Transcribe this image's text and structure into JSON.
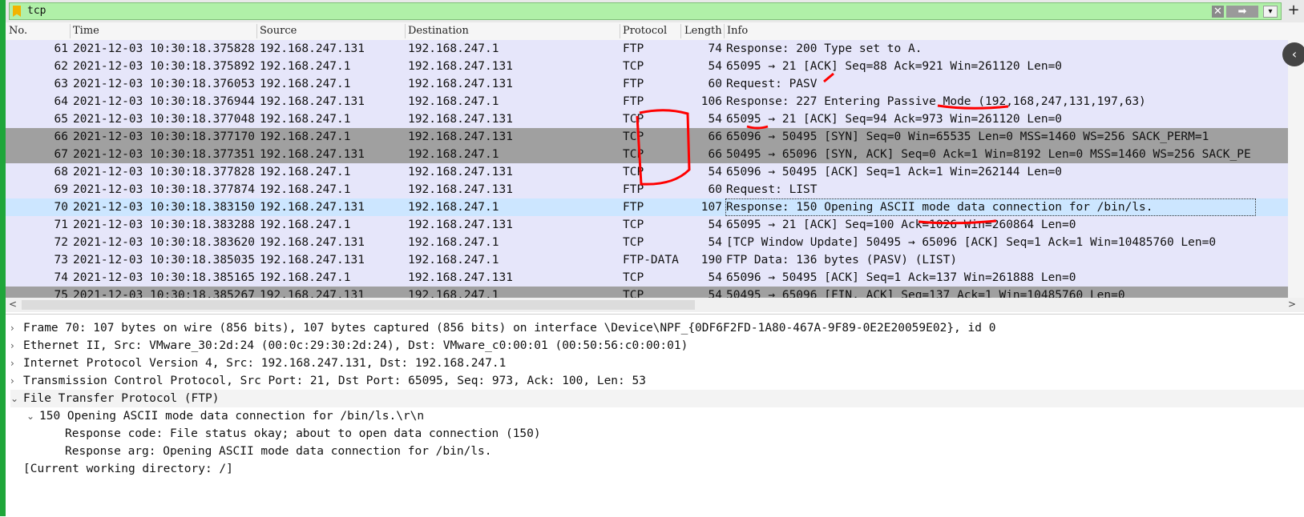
{
  "filter": {
    "value": "tcp",
    "clear_glyph": "✕",
    "apply_glyph": "➡",
    "dropdown_glyph": "▾",
    "add_glyph": "+"
  },
  "columns": {
    "no": "No.",
    "time": "Time",
    "source": "Source",
    "destination": "Destination",
    "protocol": "Protocol",
    "length": "Length",
    "info": "Info"
  },
  "packets": [
    {
      "no": "61",
      "time": "2021-12-03 10:30:18.375828",
      "src": "192.168.247.131",
      "dst": "192.168.247.1",
      "proto": "FTP",
      "len": "74",
      "info": "Response: 200 Type set to A.",
      "style": "ftp"
    },
    {
      "no": "62",
      "time": "2021-12-03 10:30:18.375892",
      "src": "192.168.247.1",
      "dst": "192.168.247.131",
      "proto": "TCP",
      "len": "54",
      "info": "65095 → 21 [ACK] Seq=88 Ack=921 Win=261120 Len=0",
      "style": "tcp"
    },
    {
      "no": "63",
      "time": "2021-12-03 10:30:18.376053",
      "src": "192.168.247.1",
      "dst": "192.168.247.131",
      "proto": "FTP",
      "len": "60",
      "info": "Request: PASV",
      "style": "ftp"
    },
    {
      "no": "64",
      "time": "2021-12-03 10:30:18.376944",
      "src": "192.168.247.131",
      "dst": "192.168.247.1",
      "proto": "FTP",
      "len": "106",
      "info": "Response: 227 Entering Passive Mode (192,168,247,131,197,63)",
      "style": "ftp"
    },
    {
      "no": "65",
      "time": "2021-12-03 10:30:18.377048",
      "src": "192.168.247.1",
      "dst": "192.168.247.131",
      "proto": "TCP",
      "len": "54",
      "info": "65095 → 21 [ACK] Seq=94 Ack=973 Win=261120 Len=0",
      "style": "tcp"
    },
    {
      "no": "66",
      "time": "2021-12-03 10:30:18.377170",
      "src": "192.168.247.1",
      "dst": "192.168.247.131",
      "proto": "TCP",
      "len": "66",
      "info": "65096 → 50495 [SYN] Seq=0 Win=65535 Len=0 MSS=1460 WS=256 SACK_PERM=1",
      "style": "syn"
    },
    {
      "no": "67",
      "time": "2021-12-03 10:30:18.377351",
      "src": "192.168.247.131",
      "dst": "192.168.247.1",
      "proto": "TCP",
      "len": "66",
      "info": "50495 → 65096 [SYN, ACK] Seq=0 Ack=1 Win=8192 Len=0 MSS=1460 WS=256 SACK_PE",
      "style": "syn"
    },
    {
      "no": "68",
      "time": "2021-12-03 10:30:18.377828",
      "src": "192.168.247.1",
      "dst": "192.168.247.131",
      "proto": "TCP",
      "len": "54",
      "info": "65096 → 50495 [ACK] Seq=1 Ack=1 Win=262144 Len=0",
      "style": "tcp"
    },
    {
      "no": "69",
      "time": "2021-12-03 10:30:18.377874",
      "src": "192.168.247.1",
      "dst": "192.168.247.131",
      "proto": "FTP",
      "len": "60",
      "info": "Request: LIST",
      "style": "ftp"
    },
    {
      "no": "70",
      "time": "2021-12-03 10:30:18.383150",
      "src": "192.168.247.131",
      "dst": "192.168.247.1",
      "proto": "FTP",
      "len": "107",
      "info": "Response: 150 Opening ASCII mode data connection for /bin/ls.",
      "style": "sel"
    },
    {
      "no": "71",
      "time": "2021-12-03 10:30:18.383288",
      "src": "192.168.247.1",
      "dst": "192.168.247.131",
      "proto": "TCP",
      "len": "54",
      "info": "65095 → 21 [ACK] Seq=100 Ack=1026 Win=260864 Len=0",
      "style": "tcp"
    },
    {
      "no": "72",
      "time": "2021-12-03 10:30:18.383620",
      "src": "192.168.247.131",
      "dst": "192.168.247.1",
      "proto": "TCP",
      "len": "54",
      "info": "[TCP Window Update] 50495 → 65096 [ACK] Seq=1 Ack=1 Win=10485760 Len=0",
      "style": "tcp"
    },
    {
      "no": "73",
      "time": "2021-12-03 10:30:18.385035",
      "src": "192.168.247.131",
      "dst": "192.168.247.1",
      "proto": "FTP-DATA",
      "len": "190",
      "info": "FTP Data: 136 bytes (PASV) (LIST)",
      "style": "ftp"
    },
    {
      "no": "74",
      "time": "2021-12-03 10:30:18.385165",
      "src": "192.168.247.1",
      "dst": "192.168.247.131",
      "proto": "TCP",
      "len": "54",
      "info": "65096 → 50495 [ACK] Seq=1 Ack=137 Win=261888 Len=0",
      "style": "tcp"
    },
    {
      "no": "75",
      "time": "2021-12-03 10:30:18.385267",
      "src": "192.168.247.131",
      "dst": "192.168.247.1",
      "proto": "TCP",
      "len": "54",
      "info": "50495 → 65096 [FIN, ACK] Seq=137 Ack=1 Win=10485760 Len=0",
      "style": "syn"
    }
  ],
  "details": [
    {
      "tri": "›",
      "text": "Frame 70: 107 bytes on wire (856 bits), 107 bytes captured (856 bits) on interface \\Device\\NPF_{0DF6F2FD-1A80-467A-9F89-0E2E20059E02}, id 0",
      "indent": 0
    },
    {
      "tri": "›",
      "text": "Ethernet II, Src: VMware_30:2d:24 (00:0c:29:30:2d:24), Dst: VMware_c0:00:01 (00:50:56:c0:00:01)",
      "indent": 0
    },
    {
      "tri": "›",
      "text": "Internet Protocol Version 4, Src: 192.168.247.131, Dst: 192.168.247.1",
      "indent": 0
    },
    {
      "tri": "›",
      "text": "Transmission Control Protocol, Src Port: 21, Dst Port: 65095, Seq: 973, Ack: 100, Len: 53",
      "indent": 0
    },
    {
      "tri": "⌄",
      "text": "File Transfer Protocol (FTP)",
      "indent": 0
    },
    {
      "tri": "⌄",
      "text": "150 Opening ASCII mode data connection for /bin/ls.\\r\\n",
      "indent": 1
    },
    {
      "tri": "",
      "text": "Response code: File status okay; about to open data connection (150)",
      "indent": 2
    },
    {
      "tri": "",
      "text": "Response arg: Opening ASCII mode data connection for /bin/ls.",
      "indent": 2
    },
    {
      "tri": "",
      "text": "[Current working directory: /]",
      "indent": 0
    }
  ],
  "colors": {
    "tcp_row": "#e6e6fa",
    "syn_row": "#a0a0a0",
    "selected_row": "#cce6ff",
    "filter_ok": "#b0f0a8",
    "annotation": "#ff0000"
  }
}
